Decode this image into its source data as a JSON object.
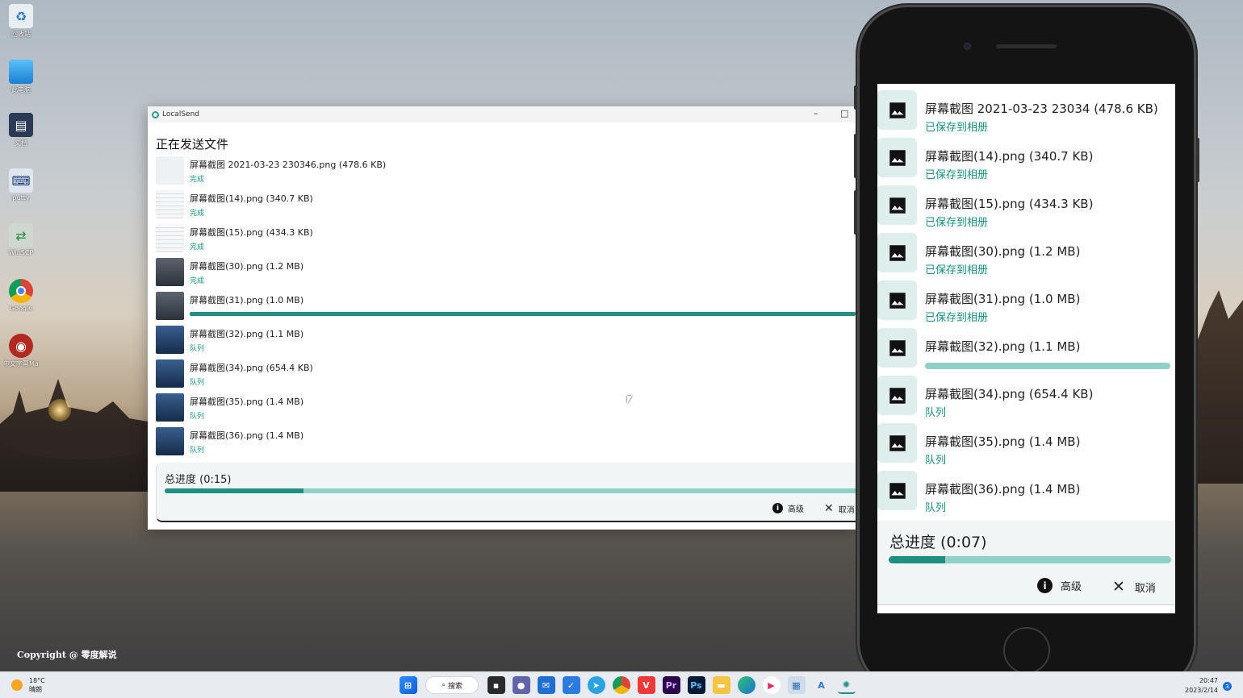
{
  "desktop": {
    "icons": [
      {
        "label": "回收站",
        "icon": "recycle-bin-icon"
      },
      {
        "label": "此电脑",
        "icon": "monitor-icon"
      },
      {
        "label": "文档",
        "icon": "documents-icon"
      },
      {
        "label": "putty",
        "icon": "putty-icon"
      },
      {
        "label": "WinSCP",
        "icon": "winscp-icon"
      },
      {
        "label": "Google",
        "icon": "chrome-icon"
      },
      {
        "label": "中文字幕Mars",
        "icon": "eye-icon"
      }
    ],
    "copyright": "Copyright @ 零度解说"
  },
  "window": {
    "title": "LocalSend",
    "heading": "正在发送文件",
    "files": [
      {
        "name": "屏幕截图 2021-03-23 230346.png (478.6 KB)",
        "status": "完成"
      },
      {
        "name": "屏幕截图(14).png (340.7 KB)",
        "status": "完成"
      },
      {
        "name": "屏幕截图(15).png (434.3 KB)",
        "status": "完成"
      },
      {
        "name": "屏幕截图(30).png (1.2 MB)",
        "status": "完成"
      },
      {
        "name": "屏幕截图(31).png (1.0 MB)",
        "status": "",
        "progress": 1.0
      },
      {
        "name": "屏幕截图(32).png (1.1 MB)",
        "status": "队列"
      },
      {
        "name": "屏幕截图(34).png (654.4 KB)",
        "status": "队列"
      },
      {
        "name": "屏幕截图(35).png (1.4 MB)",
        "status": "队列"
      },
      {
        "name": "屏幕截图(36).png (1.4 MB)",
        "status": "队列"
      }
    ],
    "total_label": "总进度 (0:15)",
    "total_progress": 0.2,
    "advanced_label": "高级",
    "cancel_label": "取消"
  },
  "phone": {
    "files": [
      {
        "name": "屏幕截图 2021-03-23 23034 (478.6 KB)",
        "status": "已保存到相册"
      },
      {
        "name": "屏幕截图(14).png (340.7 KB)",
        "status": "已保存到相册"
      },
      {
        "name": "屏幕截图(15).png (434.3 KB)",
        "status": "已保存到相册"
      },
      {
        "name": "屏幕截图(30).png (1.2 MB)",
        "status": "已保存到相册"
      },
      {
        "name": "屏幕截图(31).png (1.0 MB)",
        "status": "已保存到相册"
      },
      {
        "name": "屏幕截图(32).png (1.1 MB)",
        "status": "",
        "progress": 0.0
      },
      {
        "name": "屏幕截图(34).png (654.4 KB)",
        "status": "队列"
      },
      {
        "name": "屏幕截图(35).png (1.4 MB)",
        "status": "队列"
      },
      {
        "name": "屏幕截图(36).png (1.4 MB)",
        "status": "队列"
      }
    ],
    "total_label": "总进度 (0:07)",
    "total_progress": 0.2,
    "advanced_label": "高级",
    "cancel_label": "取消"
  },
  "taskbar": {
    "weather_temp": "18°C",
    "weather_desc": "晴朗",
    "search_label": "搜索",
    "apps": [
      "windows-start-icon",
      "task-view-icon",
      "chat-icon",
      "mail-icon",
      "todo-icon",
      "telegram-icon",
      "chrome-icon",
      "vivaldi-icon",
      "premiere-icon",
      "photoshop-icon",
      "file-explorer-icon",
      "edge-icon",
      "media-player-icon",
      "photos-icon",
      "app-icon",
      "localsend-icon"
    ],
    "time": "20:47",
    "date": "2023/2/14",
    "notifications": "3"
  },
  "colors": {
    "accent": "#1e8f80",
    "accent_light": "#8fd1c8",
    "status": "#149181"
  }
}
